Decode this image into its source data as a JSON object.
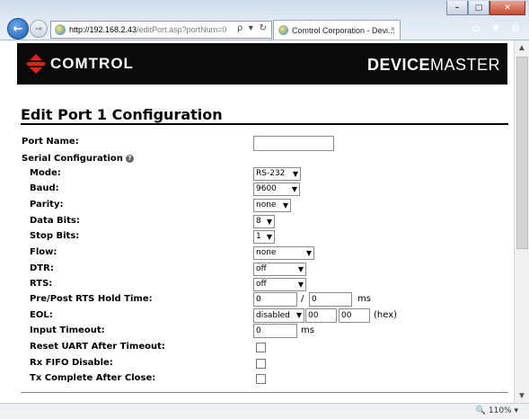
{
  "browser": {
    "url_host": "http://192.168.2.43",
    "url_path": "/editPort.asp?portNum=0",
    "url_tools": "ρ ▾ ↻",
    "tab_title": "Comtrol Corporation - Devi...",
    "tab_close": "×",
    "zoom": "110%"
  },
  "header": {
    "logo_text": "Comtrol",
    "product_bold": "DEVICE",
    "product_rest": "MASTER"
  },
  "page": {
    "title": "Edit Port 1 Configuration"
  },
  "form": {
    "port_name_label": "Port Name:",
    "port_name_value": "",
    "serial_config_label": "Serial Configuration",
    "mode_label": "Mode:",
    "mode_value": "RS-232",
    "baud_label": "Baud:",
    "baud_value": "9600",
    "parity_label": "Parity:",
    "parity_value": "none",
    "data_bits_label": "Data Bits:",
    "data_bits_value": "8",
    "stop_bits_label": "Stop Bits:",
    "stop_bits_value": "1",
    "flow_label": "Flow:",
    "flow_value": "none",
    "dtr_label": "DTR:",
    "dtr_value": "off",
    "rts_label": "RTS:",
    "rts_value": "off",
    "hold_label": "Pre/Post RTS Hold Time:",
    "hold_pre_value": "0",
    "hold_sep": "/",
    "hold_post_value": "0",
    "hold_unit": "ms",
    "eol_label": "EOL:",
    "eol_mode_value": "disabled",
    "eol_byte1_value": "00",
    "eol_byte2_value": "00",
    "eol_unit": "(hex)",
    "input_timeout_label": "Input Timeout:",
    "input_timeout_value": "0",
    "input_timeout_unit": "ms",
    "reset_uart_label": "Reset UART After Timeout:",
    "reset_uart_checked": false,
    "rx_fifo_label": "Rx FIFO Disable:",
    "rx_fifo_checked": false,
    "tx_complete_label": "Tx Complete After Close:",
    "tx_complete_checked": false
  },
  "icons": {
    "back": "back-arrow-icon",
    "forward": "forward-arrow-icon",
    "home": "home-icon",
    "favorites": "star-icon",
    "settings": "gear-icon",
    "help": "help-icon",
    "chevron": "chevron-down-icon"
  }
}
